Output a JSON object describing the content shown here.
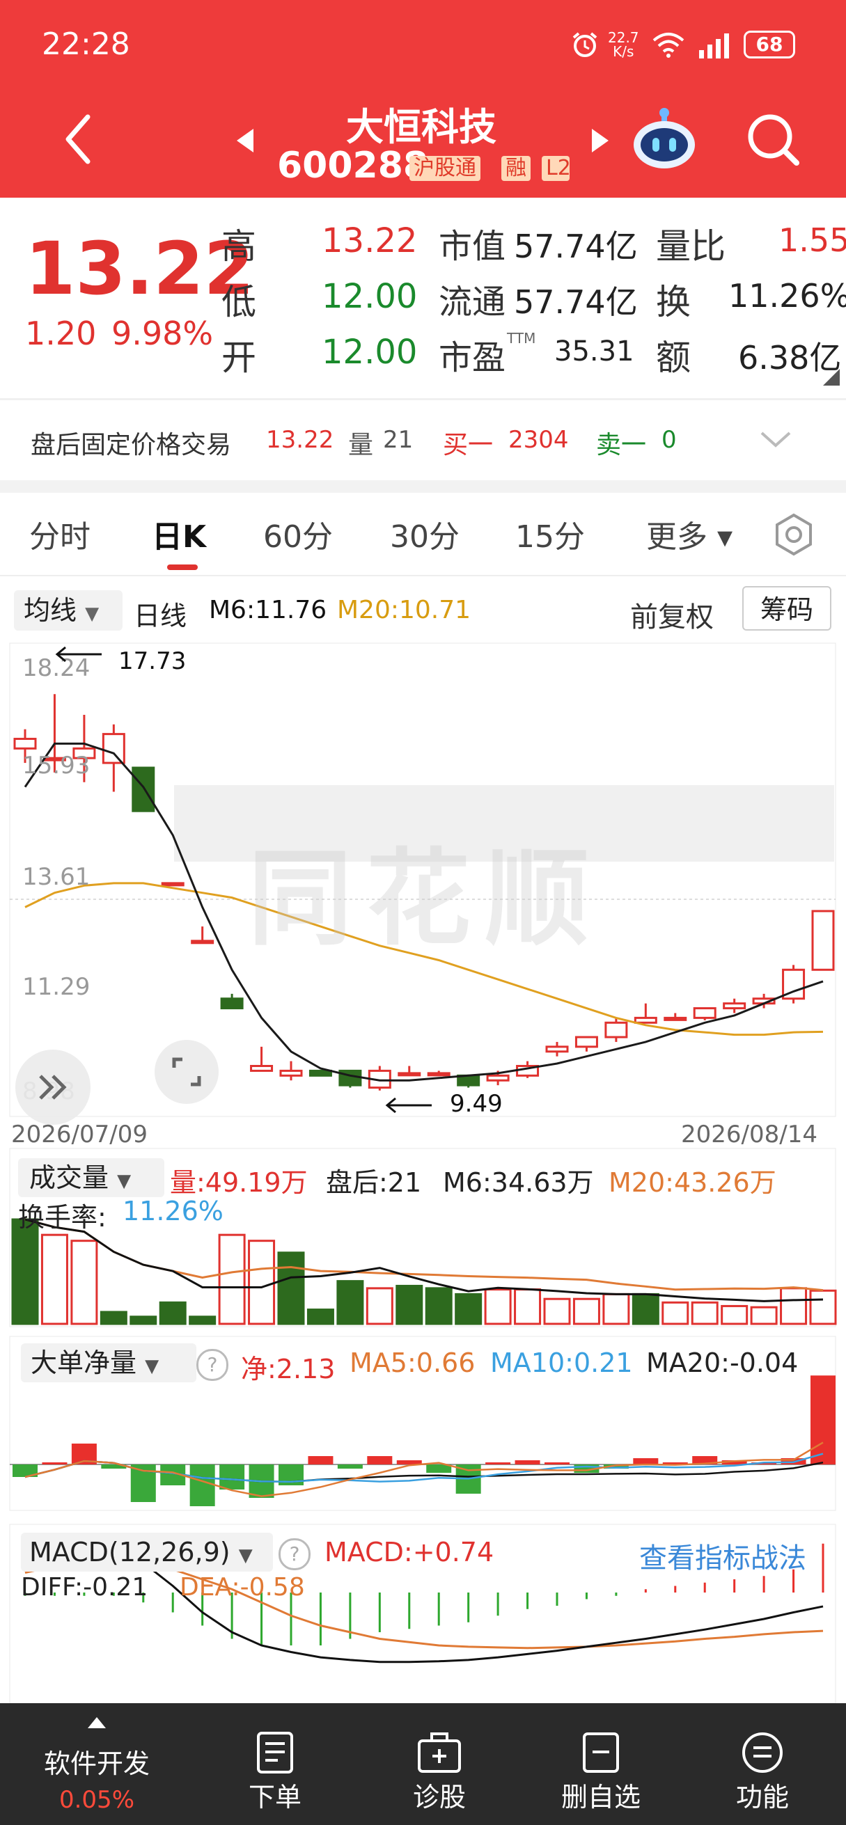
{
  "status": {
    "time": "22:28",
    "speed_top": "22.7",
    "speed_unit": "K/s",
    "battery": "68"
  },
  "header": {
    "title": "大恒科技",
    "code": "600288",
    "badge1": "沪股通",
    "badge2": "融",
    "badge3": "L2"
  },
  "quote": {
    "price": "13.22",
    "change": "1.20",
    "change_pct": "9.98%",
    "high_label": "高",
    "high": "13.22",
    "low_label": "低",
    "low": "12.00",
    "open_label": "开",
    "open": "12.00",
    "mcap_label": "市值",
    "mcap": "57.74亿",
    "float_label": "流通",
    "float": "57.74亿",
    "pe_label": "市盈",
    "pe_sup": "TTM",
    "pe": "35.31",
    "vr_label": "量比",
    "vr": "1.55",
    "turn_label": "换",
    "turn": "11.26%",
    "amt_label": "额",
    "amt": "6.38亿"
  },
  "afterhours": {
    "label": "盘后固定价格交易",
    "price": "13.22",
    "vol_label": "量",
    "vol": "21",
    "buy1_label": "买一",
    "buy1": "2304",
    "sell1_label": "卖一",
    "sell1": "0"
  },
  "tabs": [
    "分时",
    "日K",
    "60分",
    "30分",
    "15分",
    "更多"
  ],
  "active_tab": "日K",
  "kline": {
    "ma_select": "均线",
    "period": "日线",
    "m6": "M6:11.76",
    "m20": "M20:10.71",
    "adjust": "前复权",
    "chips": "筹码",
    "y_labels": [
      "18.24",
      "15.93",
      "13.61",
      "11.29",
      "8.98"
    ],
    "max_note": "17.73",
    "min_note": "9.49",
    "date_start": "2026/07/09",
    "date_end": "2026/08/14",
    "watermark": "同花顺"
  },
  "volume": {
    "select": "成交量",
    "vol": "量:49.19万",
    "after": "盘后:21",
    "m6": "M6:34.63万",
    "m20": "M20:43.26万",
    "turn_label": "换手率:",
    "turn": "11.26%"
  },
  "bigorder": {
    "select": "大单净量",
    "net": "净:2.13",
    "ma5": "MA5:0.66",
    "ma10": "MA10:0.21",
    "ma20": "MA20:-0.04"
  },
  "macd": {
    "select": "MACD(12,26,9)",
    "macd": "MACD:+0.74",
    "link": "查看指标战法",
    "diff": "DIFF:-0.21",
    "dea": "DEA:-0.58"
  },
  "nav": {
    "dev_label": "软件开发",
    "dev_pct": "0.05%",
    "items": [
      "下单",
      "诊股",
      "删自选",
      "功能"
    ]
  },
  "colors": {
    "header": "#ee3b3b",
    "up": "#e0322f",
    "down": "#2d6a1e",
    "ma6": "#1a1a1a",
    "ma20": "#e0a020",
    "nav": "#2a2a2a"
  },
  "chart_data": {
    "type": "candlestick",
    "ohlc": [
      [
        16.6,
        17.0,
        16.3,
        16.8
      ],
      [
        16.4,
        17.73,
        16.1,
        16.4
      ],
      [
        16.4,
        17.3,
        15.9,
        16.6
      ],
      [
        16.3,
        17.1,
        15.7,
        16.9
      ],
      [
        16.2,
        16.2,
        15.3,
        15.3
      ],
      [
        13.8,
        13.8,
        13.8,
        13.8
      ],
      [
        12.6,
        12.9,
        12.6,
        12.6
      ],
      [
        11.4,
        11.5,
        11.2,
        11.2
      ],
      [
        9.9,
        10.4,
        9.9,
        10.0
      ],
      [
        9.8,
        10.1,
        9.7,
        9.9
      ],
      [
        9.9,
        9.9,
        9.8,
        9.8
      ],
      [
        9.9,
        9.9,
        9.55,
        9.6
      ],
      [
        9.55,
        10.0,
        9.49,
        9.9
      ],
      [
        9.85,
        10.0,
        9.8,
        9.85
      ],
      [
        9.85,
        9.9,
        9.8,
        9.85
      ],
      [
        9.8,
        9.8,
        9.55,
        9.6
      ],
      [
        9.7,
        9.9,
        9.6,
        9.8
      ],
      [
        9.8,
        10.1,
        9.75,
        10.0
      ],
      [
        10.3,
        10.5,
        10.2,
        10.4
      ],
      [
        10.4,
        10.6,
        10.3,
        10.6
      ],
      [
        10.6,
        11.0,
        10.5,
        10.9
      ],
      [
        10.9,
        11.3,
        10.9,
        11.0
      ],
      [
        11.0,
        11.1,
        10.95,
        11.0
      ],
      [
        11.0,
        11.2,
        10.95,
        11.2
      ],
      [
        11.2,
        11.4,
        11.1,
        11.3
      ],
      [
        11.3,
        11.5,
        11.2,
        11.4
      ],
      [
        11.4,
        12.1,
        11.3,
        12.0
      ],
      [
        12.0,
        13.22,
        12.0,
        13.22
      ]
    ],
    "m6": [
      15.8,
      16.7,
      16.7,
      16.5,
      15.8,
      14.8,
      13.3,
      12.0,
      11.0,
      10.3,
      9.95,
      9.8,
      9.7,
      9.7,
      9.75,
      9.8,
      9.85,
      9.95,
      10.05,
      10.2,
      10.35,
      10.5,
      10.7,
      10.9,
      11.05,
      11.3,
      11.55,
      11.76
    ],
    "m20": [
      13.3,
      13.6,
      13.75,
      13.8,
      13.8,
      13.7,
      13.6,
      13.5,
      13.3,
      13.1,
      12.9,
      12.7,
      12.5,
      12.35,
      12.2,
      12.0,
      11.8,
      11.6,
      11.4,
      11.2,
      11.0,
      10.85,
      10.75,
      10.7,
      10.65,
      10.65,
      10.7,
      10.71
    ],
    "ylim": [
      8.98,
      18.24
    ],
    "volume": [
      88,
      75,
      70,
      10,
      6,
      18,
      6,
      75,
      70,
      60,
      12,
      36,
      30,
      32,
      30,
      25,
      29,
      29,
      21,
      21,
      25,
      25,
      18,
      18,
      15,
      14,
      30,
      28
    ],
    "volume_up": [
      false,
      true,
      true,
      false,
      false,
      false,
      false,
      true,
      true,
      false,
      false,
      false,
      true,
      false,
      false,
      false,
      true,
      true,
      true,
      true,
      true,
      false,
      true,
      true,
      true,
      true,
      true,
      true
    ],
    "bigorder": [
      -0.3,
      0.05,
      0.5,
      -0.1,
      -0.9,
      -0.5,
      -1.0,
      -0.6,
      -0.8,
      -0.5,
      0.2,
      -0.1,
      0.2,
      0.1,
      -0.2,
      -0.7,
      0.05,
      0.1,
      0.05,
      -0.2,
      -0.1,
      0.15,
      0.05,
      0.2,
      0.1,
      0.05,
      0.15,
      2.13
    ],
    "macd_hist": [
      -0.05,
      -0.05,
      -0.05,
      -0.05,
      -0.15,
      -0.3,
      -0.5,
      -0.7,
      -0.8,
      -0.8,
      -0.8,
      -0.7,
      -0.6,
      -0.55,
      -0.5,
      -0.45,
      -0.35,
      -0.25,
      -0.2,
      -0.1,
      -0.05,
      0.05,
      0.1,
      0.15,
      0.2,
      0.25,
      0.35,
      0.74
    ],
    "diff": [
      0.6,
      0.75,
      0.75,
      0.65,
      0.45,
      0.1,
      -0.3,
      -0.6,
      -0.8,
      -0.9,
      -0.98,
      -1.02,
      -1.05,
      -1.05,
      -1.04,
      -1.02,
      -0.98,
      -0.93,
      -0.88,
      -0.82,
      -0.76,
      -0.7,
      -0.63,
      -0.56,
      -0.48,
      -0.4,
      -0.3,
      -0.21
    ],
    "dea": [
      0.3,
      0.4,
      0.45,
      0.45,
      0.45,
      0.35,
      0.2,
      0.05,
      -0.15,
      -0.35,
      -0.5,
      -0.6,
      -0.7,
      -0.75,
      -0.8,
      -0.82,
      -0.83,
      -0.84,
      -0.83,
      -0.82,
      -0.8,
      -0.77,
      -0.74,
      -0.7,
      -0.67,
      -0.63,
      -0.6,
      -0.58
    ]
  }
}
